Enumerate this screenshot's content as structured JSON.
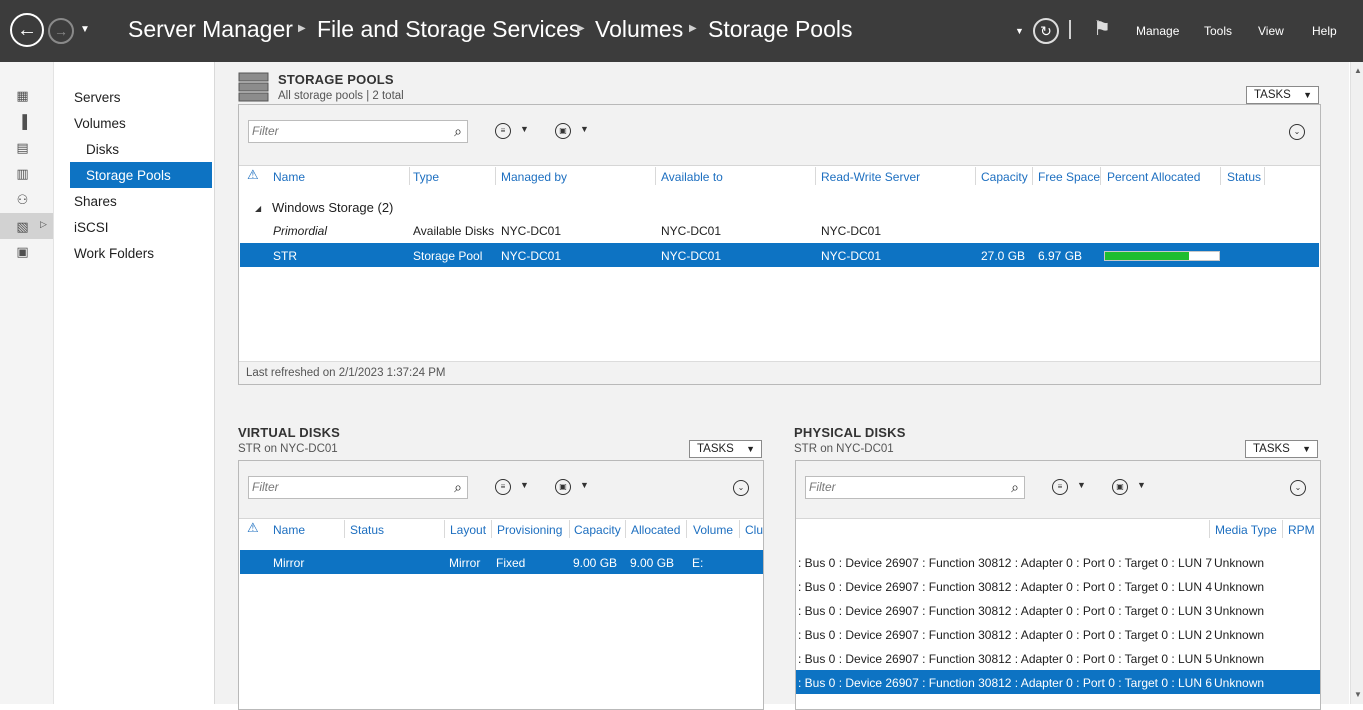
{
  "titlebar": {
    "breadcrumbs": [
      "Server Manager",
      "File and Storage Services",
      "Volumes",
      "Storage Pools"
    ],
    "menu": [
      "Manage",
      "Tools",
      "View",
      "Help"
    ],
    "icons": [
      "back-icon",
      "forward-icon",
      "refresh-icon",
      "flag-icon"
    ]
  },
  "nav": {
    "items": [
      "Servers",
      "Volumes",
      "Disks",
      "Storage Pools",
      "Shares",
      "iSCSI",
      "Work Folders"
    ],
    "selected": "Storage Pools"
  },
  "pools": {
    "title": "STORAGE POOLS",
    "subtitle": "All storage pools | 2 total",
    "tasks": "TASKS",
    "filter_placeholder": "Filter",
    "columns": [
      "Name",
      "Type",
      "Managed by",
      "Available to",
      "Read-Write Server",
      "Capacity",
      "Free Space",
      "Percent Allocated",
      "Status"
    ],
    "group": "Windows Storage (2)",
    "rows": [
      {
        "name": "Primordial",
        "type": "Available Disks",
        "managed_by": "NYC-DC01",
        "available_to": "NYC-DC01",
        "rw_server": "NYC-DC01",
        "capacity": "",
        "free_space": "",
        "percent_allocated": null,
        "status": ""
      },
      {
        "name": "STR",
        "type": "Storage Pool",
        "managed_by": "NYC-DC01",
        "available_to": "NYC-DC01",
        "rw_server": "NYC-DC01",
        "capacity": "27.0 GB",
        "free_space": "6.97 GB",
        "percent_allocated": 0.74,
        "status": ""
      }
    ],
    "footer": "Last refreshed on 2/1/2023 1:37:24 PM"
  },
  "virtual_disks": {
    "title": "VIRTUAL DISKS",
    "subtitle": "STR on NYC-DC01",
    "tasks": "TASKS",
    "filter_placeholder": "Filter",
    "columns": [
      "Name",
      "Status",
      "Layout",
      "Provisioning",
      "Capacity",
      "Allocated",
      "Volume",
      "Clu"
    ],
    "rows": [
      {
        "name": "Mirror",
        "status": "",
        "layout": "Mirror",
        "provisioning": "Fixed",
        "capacity": "9.00 GB",
        "allocated": "9.00 GB",
        "volume": "E:"
      }
    ]
  },
  "physical_disks": {
    "title": "PHYSICAL DISKS",
    "subtitle": "STR on NYC-DC01",
    "tasks": "TASKS",
    "filter_placeholder": "Filter",
    "columns": [
      "Media Type",
      "RPM"
    ],
    "rows": [
      {
        "desc": ": Bus 0 : Device 26907 : Function 30812 : Adapter 0 : Port 0 : Target 0 : LUN 7",
        "media": "Unknown"
      },
      {
        "desc": ": Bus 0 : Device 26907 : Function 30812 : Adapter 0 : Port 0 : Target 0 : LUN 4",
        "media": "Unknown"
      },
      {
        "desc": ": Bus 0 : Device 26907 : Function 30812 : Adapter 0 : Port 0 : Target 0 : LUN 3",
        "media": "Unknown"
      },
      {
        "desc": ": Bus 0 : Device 26907 : Function 30812 : Adapter 0 : Port 0 : Target 0 : LUN 2",
        "media": "Unknown"
      },
      {
        "desc": ": Bus 0 : Device 26907 : Function 30812 : Adapter 0 : Port 0 : Target 0 : LUN 5",
        "media": "Unknown"
      },
      {
        "desc": ": Bus 0 : Device 26907 : Function 30812 : Adapter 0 : Port 0 : Target 0 : LUN 6",
        "media": "Unknown"
      }
    ]
  },
  "colors": {
    "accent": "#0d73c3",
    "titlebar": "#3c3c3c",
    "progress": "#1ebd2f",
    "header_link": "#1d6fc0"
  }
}
